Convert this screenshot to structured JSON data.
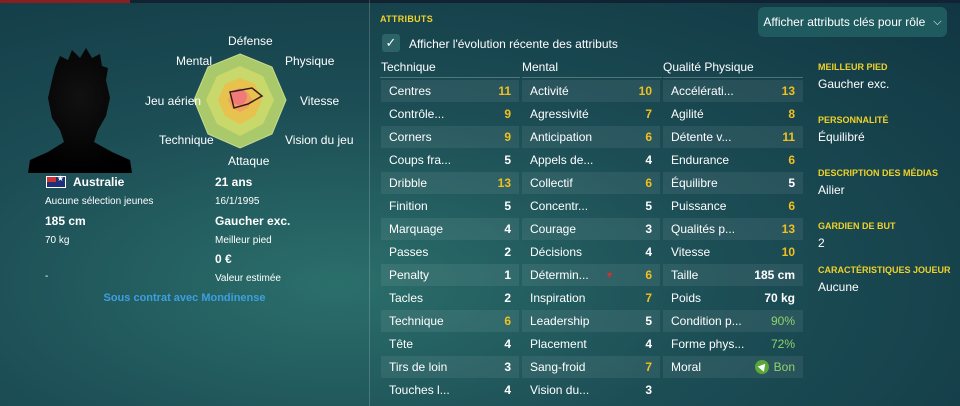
{
  "player": {
    "nationality": "Australie",
    "caps": "Aucune sélection jeunes",
    "height": "185 cm",
    "weight": "70 kg",
    "age": "21 ans",
    "dob": "16/1/1995",
    "foot_value": "Gaucher exc.",
    "foot_label": "Meilleur pied",
    "value": "0 €",
    "value_label": "Valeur estimée",
    "dash": "-",
    "contract": "Sous contrat avec Mondinense"
  },
  "radar": {
    "labels": {
      "defense": "Défense",
      "physique": "Physique",
      "vitesse": "Vitesse",
      "vision": "Vision du jeu",
      "attaque": "Attaque",
      "technique": "Technique",
      "aerien": "Jeu aérien",
      "mental": "Mental"
    }
  },
  "header": {
    "section_title": "ATTRIBUTS",
    "button_label": "Afficher attributs clés pour rôle",
    "checkbox_label": "Afficher l'évolution récente des attributs"
  },
  "columns": {
    "technique": {
      "title": "Technique",
      "rows": [
        {
          "name": "Centres",
          "value": "11",
          "color": "yellow"
        },
        {
          "name": "Contrôle...",
          "value": "9",
          "color": "yellow"
        },
        {
          "name": "Corners",
          "value": "9",
          "color": "yellow"
        },
        {
          "name": "Coups fra...",
          "value": "5",
          "color": "white"
        },
        {
          "name": "Dribble",
          "value": "13",
          "color": "yellow"
        },
        {
          "name": "Finition",
          "value": "5",
          "color": "white"
        },
        {
          "name": "Marquage",
          "value": "4",
          "color": "white"
        },
        {
          "name": "Passes",
          "value": "2",
          "color": "white"
        },
        {
          "name": "Penalty",
          "value": "1",
          "color": "white"
        },
        {
          "name": "Tacles",
          "value": "2",
          "color": "white"
        },
        {
          "name": "Technique",
          "value": "6",
          "color": "yellow"
        },
        {
          "name": "Tête",
          "value": "4",
          "color": "white"
        },
        {
          "name": "Tirs de loin",
          "value": "3",
          "color": "white"
        },
        {
          "name": "Touches l...",
          "value": "4",
          "color": "white"
        }
      ]
    },
    "mental": {
      "title": "Mental",
      "rows": [
        {
          "name": "Activité",
          "value": "10",
          "color": "yellow"
        },
        {
          "name": "Agressivité",
          "value": "7",
          "color": "yellow"
        },
        {
          "name": "Anticipation",
          "value": "6",
          "color": "yellow"
        },
        {
          "name": "Appels de...",
          "value": "4",
          "color": "white"
        },
        {
          "name": "Collectif",
          "value": "6",
          "color": "yellow"
        },
        {
          "name": "Concentr...",
          "value": "5",
          "color": "white"
        },
        {
          "name": "Courage",
          "value": "3",
          "color": "white"
        },
        {
          "name": "Décisions",
          "value": "4",
          "color": "white"
        },
        {
          "name": "Détermin...",
          "value": "6",
          "color": "yellow",
          "arrow": "▼"
        },
        {
          "name": "Inspiration",
          "value": "7",
          "color": "yellow"
        },
        {
          "name": "Leadership",
          "value": "5",
          "color": "white"
        },
        {
          "name": "Placement",
          "value": "4",
          "color": "white"
        },
        {
          "name": "Sang-froid",
          "value": "7",
          "color": "yellow"
        },
        {
          "name": "Vision du...",
          "value": "3",
          "color": "white"
        }
      ]
    },
    "physique": {
      "title": "Qualité Physique",
      "rows": [
        {
          "name": "Accélérati...",
          "value": "13",
          "color": "yellow"
        },
        {
          "name": "Agilité",
          "value": "8",
          "color": "yellow"
        },
        {
          "name": "Détente v...",
          "value": "11",
          "color": "yellow"
        },
        {
          "name": "Endurance",
          "value": "6",
          "color": "yellow"
        },
        {
          "name": "Équilibre",
          "value": "5",
          "color": "white"
        },
        {
          "name": "Puissance",
          "value": "6",
          "color": "yellow"
        },
        {
          "name": "Qualités p...",
          "value": "13",
          "color": "yellow"
        },
        {
          "name": "Vitesse",
          "value": "10",
          "color": "yellow"
        }
      ],
      "extra": [
        {
          "name": "Taille",
          "value": "185 cm",
          "color": "white"
        },
        {
          "name": "Poids",
          "value": "70 kg",
          "color": "white"
        },
        {
          "name": "Condition p...",
          "value": "90%",
          "color": "green"
        },
        {
          "name": "Forme phys...",
          "value": "72%",
          "color": "green"
        },
        {
          "name": "Moral",
          "value": "Bon",
          "color": "green",
          "icon": "thumb-icon"
        }
      ]
    }
  },
  "info": [
    {
      "title": "MEILLEUR PIED",
      "value": "Gaucher exc."
    },
    {
      "title": "PERSONNALITÉ",
      "value": "Équilibré"
    },
    {
      "title": "DESCRIPTION DES MÉDIAS",
      "value": "Ailier"
    },
    {
      "title": "GARDIEN DE BUT",
      "value": "2"
    },
    {
      "title": "CARACTÉRISTIQUES JOUEUR",
      "value": "Aucune"
    }
  ],
  "colors": {
    "accent_yellow": "#f0c020",
    "title_yellow": "#f0d22a",
    "contract_blue": "#3d9fe0",
    "good_green": "#8fd36a"
  }
}
